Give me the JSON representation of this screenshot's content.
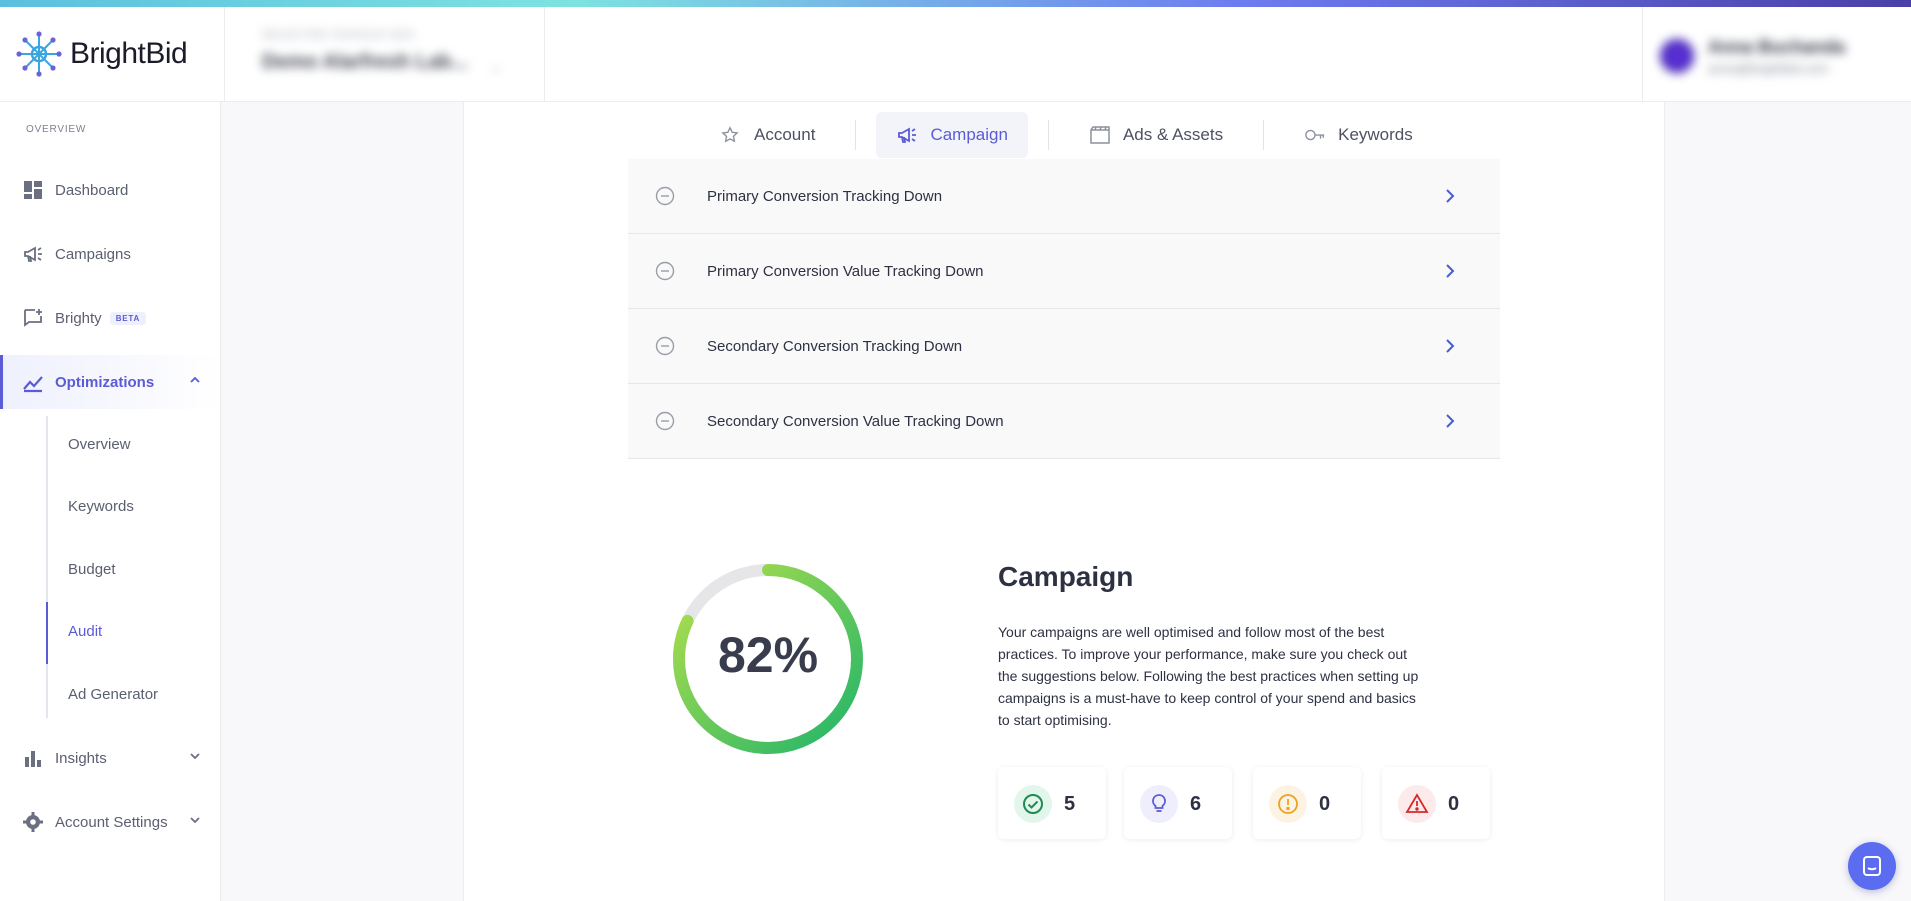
{
  "brand": {
    "name": "BrightBid",
    "gradient": [
      "#5bc0de",
      "#7de3e0",
      "#6d7cf0",
      "#4a3fa8"
    ],
    "accent": "#5b5bd6"
  },
  "header": {
    "account_label": "SELECTED GOOGLE ADS",
    "account_value": "Demo Alarfresh Lab...",
    "user_name": "Anna Buchanda",
    "user_email": "anna@brightbid.com"
  },
  "sidebar": {
    "section": "OVERVIEW",
    "items": [
      {
        "label": "Dashboard",
        "icon": "dashboard-icon"
      },
      {
        "label": "Campaigns",
        "icon": "megaphone-icon"
      },
      {
        "label": "Brighty",
        "icon": "chat-plus-icon",
        "badge": "BETA"
      },
      {
        "label": "Optimizations",
        "icon": "trend-icon",
        "active": true
      },
      {
        "label": "Insights",
        "icon": "bar-chart-icon"
      },
      {
        "label": "Account Settings",
        "icon": "gear-icon"
      }
    ],
    "subitems": [
      {
        "label": "Overview"
      },
      {
        "label": "Keywords"
      },
      {
        "label": "Budget"
      },
      {
        "label": "Audit",
        "active": true
      },
      {
        "label": "Ad Generator"
      }
    ]
  },
  "tabs": [
    {
      "label": "Account",
      "icon": "star-icon"
    },
    {
      "label": "Campaign",
      "icon": "megaphone-icon",
      "active": true
    },
    {
      "label": "Ads & Assets",
      "icon": "clapper-icon"
    },
    {
      "label": "Keywords",
      "icon": "key-icon"
    }
  ],
  "checks": [
    {
      "label": "Primary Conversion Tracking Down"
    },
    {
      "label": "Primary Conversion Value Tracking Down"
    },
    {
      "label": "Secondary Conversion Tracking Down"
    },
    {
      "label": "Secondary Conversion Value Tracking Down"
    }
  ],
  "score": {
    "value": 82,
    "display": "82%"
  },
  "summary": {
    "title": "Campaign",
    "description": "Your campaigns are well optimised and follow most of the best practices. To improve your performance, make sure you check out the suggestions below. Following the best practices when setting up campaigns is a must-have to keep control of your spend and basics to start optimising."
  },
  "stats": [
    {
      "kind": "passed",
      "icon": "check-circle-icon",
      "value": "5",
      "color": "#2bb673",
      "bg": "#e3f6ec"
    },
    {
      "kind": "suggestions",
      "icon": "lightbulb-icon",
      "value": "6",
      "color": "#5b5bd6",
      "bg": "#eeeefc"
    },
    {
      "kind": "warnings",
      "icon": "exclamation-icon",
      "value": "0",
      "color": "#f0a020",
      "bg": "#fdf3e3"
    },
    {
      "kind": "errors",
      "icon": "alert-triangle-icon",
      "value": "0",
      "color": "#e03c3c",
      "bg": "#fdeaea"
    }
  ]
}
